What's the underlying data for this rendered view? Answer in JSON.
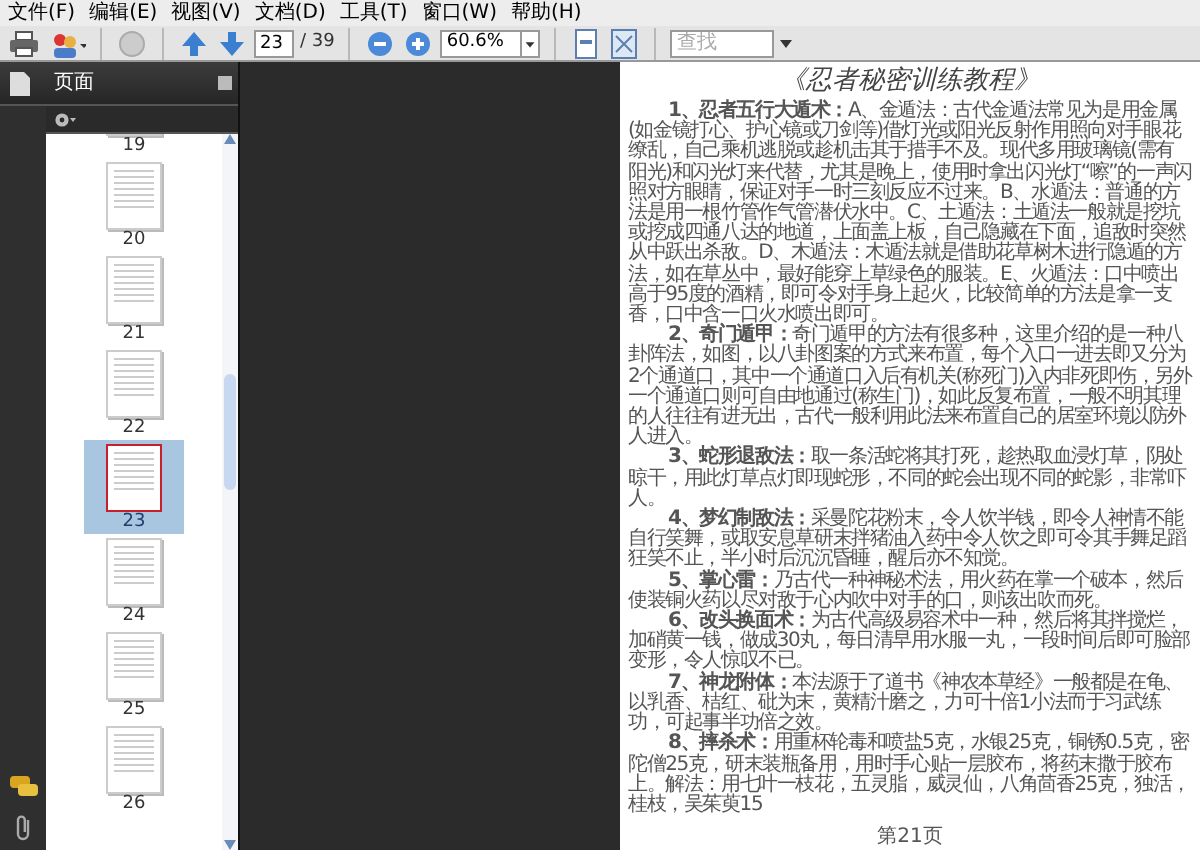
{
  "menu": [
    "文件(F)",
    "编辑(E)",
    "视图(V)",
    "文档(D)",
    "工具(T)",
    "窗口(W)",
    "帮助(H)"
  ],
  "toolbar": {
    "page_input": "23",
    "page_total": "/ 39",
    "zoom": "60.6%",
    "search": {
      "placeholder": "查找"
    }
  },
  "sidebar": {
    "title": "页面",
    "thumbnails": [
      {
        "label": "19",
        "selected": false
      },
      {
        "label": "20",
        "selected": false
      },
      {
        "label": "21",
        "selected": false
      },
      {
        "label": "22",
        "selected": false
      },
      {
        "label": "23",
        "selected": true
      },
      {
        "label": "24",
        "selected": false
      },
      {
        "label": "25",
        "selected": false
      },
      {
        "label": "26",
        "selected": false
      }
    ]
  },
  "document": {
    "title": "《忍者秘密训练教程》",
    "paragraphs": [
      "**1、忍者五行大遁术：**A、金遁法：古代金遁法常见为是用金属(如金镜打心、护心镜或刀剑等)借灯光或阳光反射作用照向对手眼花缭乱，自己乘机逃脱或趁机击其于措手不及。现代多用玻璃镜(需有阳光)和闪光灯来代替，尤其是晚上，使用时拿出闪光灯“嚓”的一声闪照对方眼睛，保证对手一时三刻反应不过来。B、水遁法：普通的方法是用一根竹管作气管潜伏水中。C、土遁法：土遁法一般就是挖坑或挖成四通八达的地道，上面盖上板，自己隐藏在下面，追敌时突然从中跃出杀敌。D、木遁法：木遁法就是借助花草树木进行隐遁的方法，如在草丛中，最好能穿上草绿色的服装。E、火遁法：口中喷出高于95度的酒精，即可令对手身上起火，比较简单的方法是拿一支香，口中含一口火水喷出即可。",
      "**2、奇门遁甲：**奇门遁甲的方法有很多种，这里介绍的是一种八卦阵法，如图，以八卦图案的方式来布置，每个入口一进去即又分为2个通道口，其中一个通道口入后有机关(称死门)入内非死即伤，另外一个通道口则可自由地通过(称生门)，如此反复布置，一般不明其理的人往往有进无出，古代一般利用此法来布置自己的居室环境以防外人进入。",
      "**3、蛇形退敌法：**取一条活蛇将其打死，趁热取血浸灯草，阴处晾干，用此灯草点灯即现蛇形，不同的蛇会出现不同的蛇影，非常吓人。",
      "**4、梦幻制敌法：**采曼陀花粉末，令人饮半钱，即令人神情不能自行笑舞，或取安息草研末拌猪油入药中令人饮之即可令其手舞足蹈狂笑不止，半小时后沉沉昏睡，醒后亦不知觉。",
      "**5、掌心雷：**乃古代一种神秘术法，用火药在掌一个破本，然后使装铜火药以尽对敌于心内吹中对手的口，则该出吹而死。",
      "**6、改头换面术：**为古代高级易容术中一种，然后将其拌搅烂，加硝黄一钱，做成30丸，每日清早用水服一丸，一段时间后即可脸部变形，令人惊叹不已。",
      "**7、神龙附体：**本法源于了道书《神农本草经》一般都是在龟、以乳香、桔红、砒为末，黄精汁磨之，力可十倍1小法而于习武练功，可起事半功倍之效。",
      "**8、摔杀术：**用重杯轮毒和喷盐5克，水银25克，铜锈0.5克，密陀僧25克，研末装瓶备用，用时手心贴一层胶布，将药末撒于胶布上。解法：用七叶一枝花，五灵脂，威灵仙，八角茴香25克，独活，桂枝，吴茱萸15"
    ],
    "footer": "第21页"
  }
}
